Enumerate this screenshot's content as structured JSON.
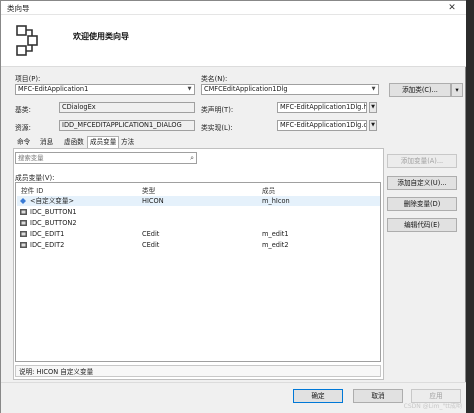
{
  "window": {
    "title": "类向导",
    "close_glyph": "✕"
  },
  "header": {
    "title": "欢迎使用类向导"
  },
  "project": {
    "label": "项目(P):",
    "value": "MFC-EditApplication1"
  },
  "classname": {
    "label": "类名(N):",
    "value": "CMFCEditApplication1Dlg"
  },
  "add_class": {
    "label": "添加类(C)...",
    "dropdown": "▾"
  },
  "base_class": {
    "label": "基类:",
    "value": "CDialogEx"
  },
  "class_decl": {
    "label": "类声明(T):",
    "value": "MFC-EditApplication1Dlg.h"
  },
  "resource": {
    "label": "资源:",
    "value": "IDD_MFCEDITAPPLICATION1_DIALOG"
  },
  "class_impl": {
    "label": "类实现(L):",
    "value": "MFC-EditApplication1Dlg.c"
  },
  "tabs": [
    "命令",
    "消息",
    "虚函数",
    "成员变量",
    "方法"
  ],
  "search": {
    "placeholder": "搜索变量"
  },
  "members": {
    "label": "成员变量(V):",
    "headers": [
      "控件 ID",
      "类型",
      "成员"
    ],
    "rows": [
      {
        "id": "<自定义变量>",
        "type": "HICON",
        "member": "m_hIcon"
      },
      {
        "id": "IDC_BUTTON1",
        "type": "",
        "member": ""
      },
      {
        "id": "IDC_BUTTON2",
        "type": "",
        "member": ""
      },
      {
        "id": "IDC_EDIT1",
        "type": "CEdit",
        "member": "m_edit1"
      },
      {
        "id": "IDC_EDIT2",
        "type": "CEdit",
        "member": "m_edit2"
      }
    ]
  },
  "side_buttons": {
    "add_var": "添加变量(A)...",
    "add_custom": "添加自定义(U)...",
    "delete_var": "删除变量(D)",
    "edit_code": "编辑代码(E)"
  },
  "description": {
    "text": "说明:     HICON 自定义变量"
  },
  "footer": {
    "ok": "确定",
    "cancel": "取消",
    "apply": "应用"
  },
  "watermark": "CSDN @Lim_\"tt成哟",
  "colors": {
    "accent": "#0078d7",
    "selection": "#e5f1fb"
  }
}
